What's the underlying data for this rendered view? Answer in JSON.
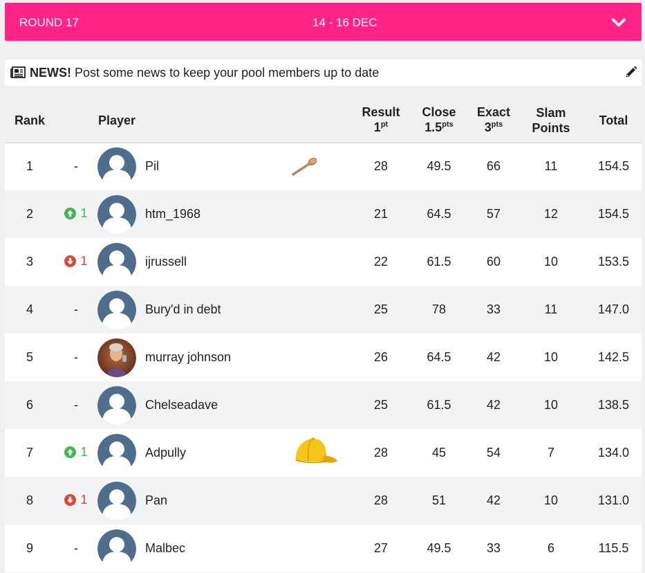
{
  "round": {
    "label": "ROUND 17",
    "dates": "14 - 16 DEC"
  },
  "news": {
    "strong": "NEWS!",
    "text": "Post some news to keep your pool members up to date"
  },
  "columns": {
    "rank": "Rank",
    "player": "Player",
    "result": "Result",
    "result_pts": "1",
    "result_unit": "pt",
    "close": "Close",
    "close_pts": "1.5",
    "close_unit": "pts",
    "exact": "Exact",
    "exact_pts": "3",
    "exact_unit": "pts",
    "slam_line1": "Slam",
    "slam_line2": "Points",
    "total": "Total"
  },
  "rows": [
    {
      "rank": "1",
      "move": "-",
      "move_dir": "none",
      "name": "Pil",
      "badge": "wooden-spoon",
      "result": "28",
      "close": "49.5",
      "exact": "66",
      "slam": "11",
      "total": "154.5",
      "avatar": "default"
    },
    {
      "rank": "2",
      "move": "1",
      "move_dir": "up",
      "name": "htm_1968",
      "badge": "",
      "result": "21",
      "close": "64.5",
      "exact": "57",
      "slam": "12",
      "total": "154.5",
      "avatar": "default"
    },
    {
      "rank": "3",
      "move": "1",
      "move_dir": "down",
      "name": "ijrussell",
      "badge": "",
      "result": "22",
      "close": "61.5",
      "exact": "60",
      "slam": "10",
      "total": "153.5",
      "avatar": "default"
    },
    {
      "rank": "4",
      "move": "-",
      "move_dir": "none",
      "name": "Bury'd in debt",
      "badge": "",
      "result": "25",
      "close": "78",
      "exact": "33",
      "slam": "11",
      "total": "147.0",
      "avatar": "default"
    },
    {
      "rank": "5",
      "move": "-",
      "move_dir": "none",
      "name": "murray johnson",
      "badge": "",
      "result": "26",
      "close": "64.5",
      "exact": "42",
      "slam": "10",
      "total": "142.5",
      "avatar": "photo"
    },
    {
      "rank": "6",
      "move": "-",
      "move_dir": "none",
      "name": "Chelseadave",
      "badge": "",
      "result": "25",
      "close": "61.5",
      "exact": "42",
      "slam": "10",
      "total": "138.5",
      "avatar": "default"
    },
    {
      "rank": "7",
      "move": "1",
      "move_dir": "up",
      "name": "Adpully",
      "badge": "yellow-cap",
      "result": "28",
      "close": "45",
      "exact": "54",
      "slam": "7",
      "total": "134.0",
      "avatar": "default"
    },
    {
      "rank": "8",
      "move": "1",
      "move_dir": "down",
      "name": "Pan",
      "badge": "",
      "result": "28",
      "close": "51",
      "exact": "42",
      "slam": "10",
      "total": "131.0",
      "avatar": "default"
    },
    {
      "rank": "9",
      "move": "-",
      "move_dir": "none",
      "name": "Malbec",
      "badge": "",
      "result": "27",
      "close": "49.5",
      "exact": "33",
      "slam": "6",
      "total": "115.5",
      "avatar": "default"
    }
  ],
  "colors": {
    "accent": "#ff2486",
    "up": "#3cb94a",
    "down": "#e04436",
    "avatar": "#4f6d8c"
  }
}
